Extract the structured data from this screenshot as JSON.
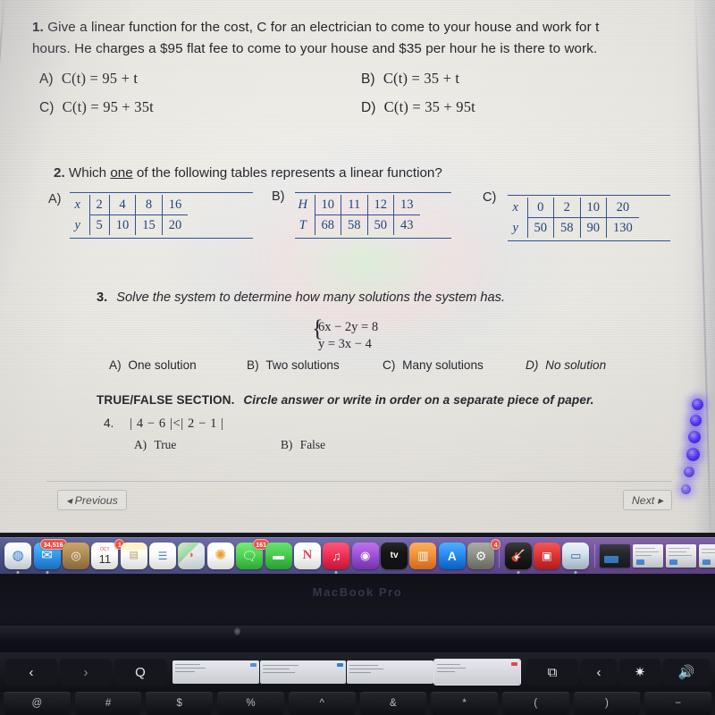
{
  "worksheet": {
    "q1": {
      "number": "1.",
      "text_line1": "Give a linear function for the cost, C for an electrician to come to your house and work for t",
      "text_line2": "hours.  He charges a $95 flat fee to come to your house and $35 per hour he is there to work.",
      "choices": [
        {
          "label": "A)",
          "expr": "C(t) = 95 + t"
        },
        {
          "label": "B)",
          "expr": "C(t) = 35 + t"
        },
        {
          "label": "C)",
          "expr": "C(t) = 95 + 35t"
        },
        {
          "label": "D)",
          "expr": "C(t) = 35 + 95t"
        }
      ]
    },
    "q2": {
      "number": "2.",
      "stem_before": "Which ",
      "stem_underlined": "one",
      "stem_after": " of the following tables represents a linear function?",
      "tables": [
        {
          "label": "A)",
          "row1_header": "x",
          "row1": [
            "2",
            "4",
            "8",
            "16"
          ],
          "row2_header": "y",
          "row2": [
            "5",
            "10",
            "15",
            "20"
          ]
        },
        {
          "label": "B)",
          "row1_header": "H",
          "row1": [
            "10",
            "11",
            "12",
            "13"
          ],
          "row2_header": "T",
          "row2": [
            "68",
            "58",
            "50",
            "43"
          ]
        },
        {
          "label": "C)",
          "row1_header": "x",
          "row1": [
            "0",
            "2",
            "10",
            "20"
          ],
          "row2_header": "y",
          "row2": [
            "50",
            "58",
            "90",
            "130"
          ]
        }
      ]
    },
    "q3": {
      "number": "3.",
      "stem": "Solve the system to determine how many solutions the system has.",
      "system_line1": "6x − 2y = 8",
      "system_line2": "y = 3x − 4",
      "choices": [
        {
          "label": "A)",
          "text": "One solution"
        },
        {
          "label": "B)",
          "text": "Two solutions"
        },
        {
          "label": "C)",
          "text": "Many solutions"
        },
        {
          "label": "D)",
          "text": "No solution"
        }
      ]
    },
    "true_false_section": {
      "heading_bold": "TRUE/FALSE SECTION.",
      "heading_italic": "Circle answer or write in order on a separate piece of paper.",
      "q4": {
        "number": "4.",
        "expression": "| 4 − 6 |<| 2 − 1 |",
        "choices": [
          {
            "label": "A)",
            "text": "True"
          },
          {
            "label": "B)",
            "text": "False"
          }
        ]
      }
    },
    "nav": {
      "previous_label": "◂ Previous",
      "next_label": "Next ▸"
    }
  },
  "dock": {
    "items": [
      {
        "name": "safari",
        "glyph": "🧭",
        "color": "#f2f5f8",
        "badge": null,
        "running": true
      },
      {
        "name": "mail",
        "glyph": "✉",
        "color": "#2e9bf0",
        "badge": "34,516",
        "running": true
      },
      {
        "name": "contacts",
        "glyph": "◎",
        "color": "#b08a54",
        "badge": null,
        "running": false
      },
      {
        "name": "calendar",
        "glyph": "11",
        "color": "#ffffff",
        "badge": "1",
        "running": false
      },
      {
        "name": "notes",
        "glyph": "▤",
        "color": "#f6e6a8",
        "badge": null,
        "running": false
      },
      {
        "name": "reminders",
        "glyph": "☰",
        "color": "#fbfbfb",
        "badge": null,
        "running": false
      },
      {
        "name": "maps",
        "glyph": "◗",
        "color": "#8fd39a",
        "badge": null,
        "running": false
      },
      {
        "name": "photos",
        "glyph": "✺",
        "color": "#fdfdfd",
        "badge": null,
        "running": false
      },
      {
        "name": "messages",
        "glyph": "💬",
        "color": "#55d45c",
        "badge": "161",
        "running": false
      },
      {
        "name": "facetime",
        "glyph": "■",
        "color": "#3cc84a",
        "badge": null,
        "running": false
      },
      {
        "name": "news",
        "glyph": "N",
        "color": "#fcfcfc",
        "badge": null,
        "running": false
      },
      {
        "name": "music",
        "glyph": "♫",
        "color": "#f3244c",
        "badge": null,
        "running": true
      },
      {
        "name": "podcasts",
        "glyph": "◉",
        "color": "#9b4ed4",
        "badge": null,
        "running": false
      },
      {
        "name": "apple-tv",
        "glyph": "tv",
        "color": "#121212",
        "badge": null,
        "running": false
      },
      {
        "name": "books",
        "glyph": "▥",
        "color": "#f3923a",
        "badge": null,
        "running": false
      },
      {
        "name": "app-store",
        "glyph": "A",
        "color": "#1e8bf5",
        "badge": null,
        "running": false
      },
      {
        "name": "system-settings",
        "glyph": "⚙",
        "color": "#8a8d84",
        "badge": "4",
        "running": false
      },
      {
        "name": "garageband",
        "glyph": "🎸",
        "color": "#1b1b1b",
        "badge": null,
        "running": true
      },
      {
        "name": "zoom",
        "glyph": "📷",
        "color": "#e03a3a",
        "badge": null,
        "running": false
      },
      {
        "name": "finder",
        "glyph": "▭",
        "color": "#d9e6f2",
        "badge": null,
        "running": true
      }
    ],
    "minimized_windows": 4
  },
  "device": {
    "brand_text": "MacBook Pro"
  },
  "touch_bar": {
    "back_icon": "‹",
    "forward_icon": "›",
    "search_icon": "Q",
    "tab_count": 4,
    "active_tab_index": 3,
    "new_tab_icon": "⧉",
    "collapse_icon": "‹",
    "brightness_icon": "✷",
    "volume_icon": "🔊"
  },
  "keyboard": {
    "keys": [
      "@",
      "#",
      "$",
      "%",
      "^",
      "&",
      "*",
      "(",
      ")",
      "−"
    ]
  },
  "colors": {
    "table_blue": "#2b4f93",
    "dock_left": "#4a4f84",
    "dock_right": "#74519f",
    "led_blue": "#5a3ff0",
    "paper": "#eae8e2"
  }
}
